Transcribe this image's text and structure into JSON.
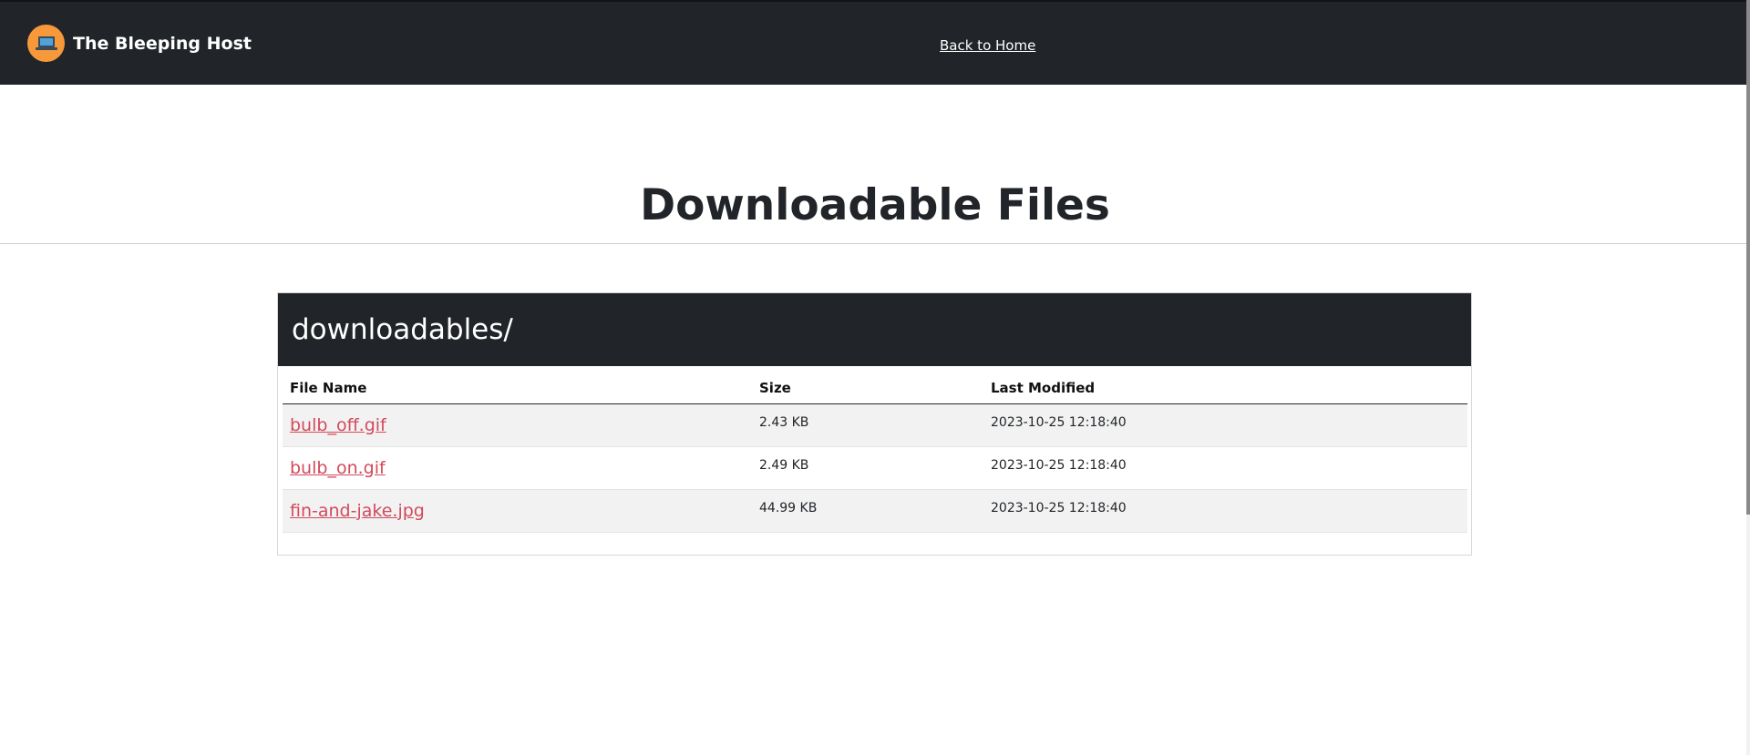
{
  "navbar": {
    "brand_name": "The Bleeping Host",
    "brand_icon": "laptop-icon",
    "home_link": "Back to Home",
    "background": "#212529",
    "logo_color": "#f7993a"
  },
  "main": {
    "title": "Downloadable Files",
    "directory": "downloadables/",
    "columns": {
      "name": "File Name",
      "size": "Size",
      "modified": "Last Modified"
    },
    "files": [
      {
        "name": "bulb_off.gif",
        "size": "2.43 KB",
        "modified": "2023-10-25 12:18:40"
      },
      {
        "name": "bulb_on.gif",
        "size": "2.49 KB",
        "modified": "2023-10-25 12:18:40"
      },
      {
        "name": "fin-and-jake.jpg",
        "size": "44.99 KB",
        "modified": "2023-10-25 12:18:40"
      }
    ],
    "link_color": "#d24a5c"
  }
}
